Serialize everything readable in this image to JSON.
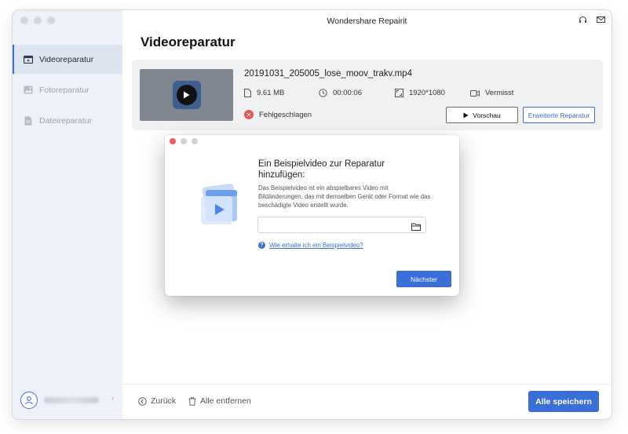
{
  "app": {
    "title": "Wondershare Repairit"
  },
  "sidebar": {
    "items": [
      {
        "label": "Videoreparatur",
        "icon": "video-icon",
        "active": true
      },
      {
        "label": "Fotoreparatur",
        "icon": "photo-icon",
        "active": false
      },
      {
        "label": "Dateireparatur",
        "icon": "file-icon",
        "active": false
      }
    ],
    "user": {
      "icon": "user-icon"
    }
  },
  "header": {
    "title": "Videoreparatur"
  },
  "file": {
    "name": "20191031_205005_lose_moov_trakv.mp4",
    "size": "9.61 MB",
    "duration": "00:00:06",
    "resolution": "1920*1080",
    "status_extra": "Vermisst",
    "status": "Fehlgeschlagen",
    "preview_label": "Vorschau",
    "advanced_label": "Erweiterte Reparatur"
  },
  "footer": {
    "back_label": "Zurück",
    "remove_label": "Alle entfernen",
    "save_label": "Alle speichern"
  },
  "dialog": {
    "title": "Ein Beispielvideo zur Reparatur hinzufügen:",
    "description": "Das Beispielvideo ist ein abspielbares Video mit Bildänderungen, das mit demselben Gerät oder Format wie das beschädigte Video erstellt wurde.",
    "input_value": "",
    "help_link": "Wie erhalte ich ein Beispielvideo?",
    "next_label": "Nächster"
  },
  "colors": {
    "accent": "#3b6fd8",
    "error": "#e05a4f",
    "sidebar_bg": "#eef2f8"
  }
}
